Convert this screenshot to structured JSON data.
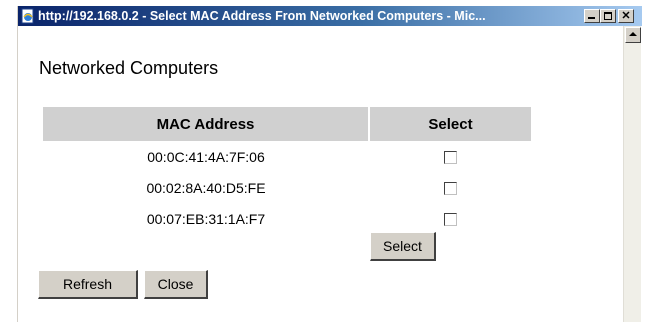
{
  "window": {
    "title": "http://192.168.0.2 - Select MAC Address From Networked Computers - Mic..."
  },
  "page": {
    "heading": "Networked Computers"
  },
  "table": {
    "headers": [
      "MAC Address",
      "Select"
    ],
    "rows": [
      {
        "mac": "00:0C:41:4A:7F:06",
        "checked": false
      },
      {
        "mac": "00:02:8A:40:D5:FE",
        "checked": false
      },
      {
        "mac": "00:07:EB:31:1A:F7",
        "checked": false
      }
    ]
  },
  "buttons": {
    "select": "Select",
    "refresh": "Refresh",
    "close": "Close"
  },
  "icons": {
    "title": "ie-page-icon",
    "minimize": "minimize-icon",
    "maximize": "maximize-icon",
    "close": "close-icon",
    "scroll_up": "scroll-up-arrow-icon"
  },
  "colors": {
    "titlebar_start": "#0a246a",
    "titlebar_end": "#a6caf0",
    "table_header_bg": "#d0d0d0",
    "button_face": "#d4d0c8"
  }
}
